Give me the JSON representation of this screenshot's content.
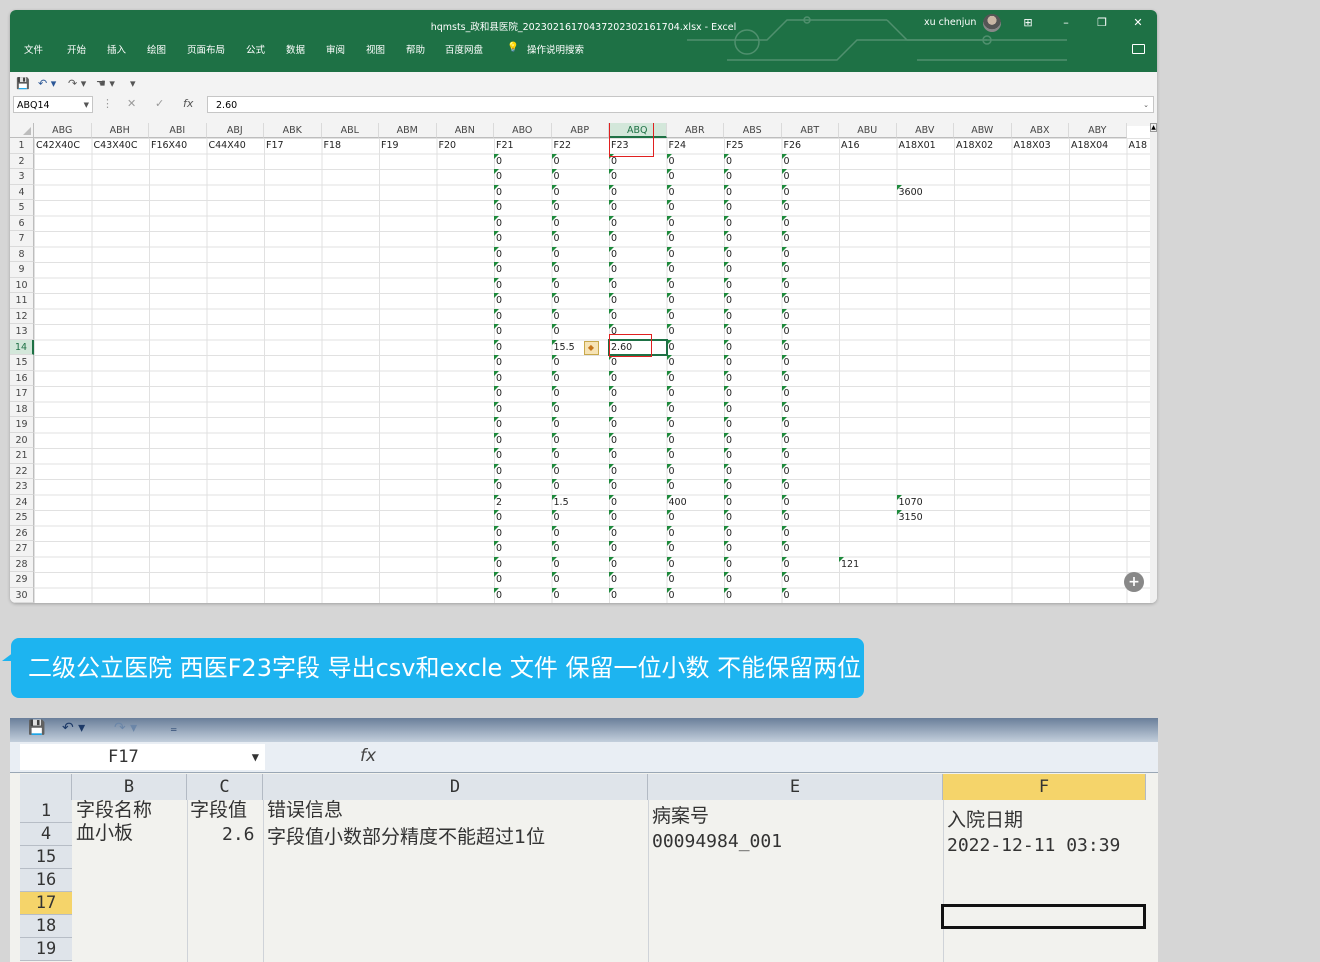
{
  "excel": {
    "title": "hqmsts_政和县医院_20230216170437202302161704.xlsx  -  Excel",
    "user": "xu chenjun",
    "menu": [
      "文件",
      "开始",
      "插入",
      "绘图",
      "页面布局",
      "公式",
      "数据",
      "审阅",
      "视图",
      "帮助",
      "百度网盘",
      "操作说明搜索"
    ],
    "namebox": "ABQ14",
    "formula": "2.60",
    "columns": [
      "ABG",
      "ABH",
      "ABI",
      "ABJ",
      "ABK",
      "ABL",
      "ABM",
      "ABN",
      "ABO",
      "ABP",
      "ABQ",
      "ABR",
      "ABS",
      "ABT",
      "ABU",
      "ABV",
      "ABW",
      "ABX",
      "ABY"
    ],
    "selected_column": "ABQ",
    "header_row": [
      "C42X40C",
      "C43X40C",
      "F16X40",
      "C44X40",
      "F17",
      "F18",
      "F19",
      "F20",
      "F21",
      "F22",
      "F23",
      "F24",
      "F25",
      "F26",
      "A16",
      "A18X01",
      "A18X02",
      "A18X03",
      "A18X04",
      "A18"
    ],
    "rows": [
      "1",
      "2",
      "3",
      "4",
      "5",
      "6",
      "7",
      "8",
      "9",
      "10",
      "11",
      "12",
      "13",
      "14",
      "15",
      "16",
      "17",
      "18",
      "19",
      "20",
      "21",
      "22",
      "23",
      "24",
      "25",
      "26",
      "27",
      "28",
      "29",
      "30"
    ],
    "selected_row": "14",
    "zero_value": "0",
    "special_values": {
      "r4_ABV": "3600",
      "r14_ABP": "15.5",
      "r14_ABQ": "2.60",
      "r24_ABO": "2",
      "r24_ABP": "1.5",
      "r24_ABR": "400",
      "r24_ABV": "1070",
      "r25_ABV": "3150",
      "r28_ABU": "121"
    }
  },
  "message": "二级公立医院 西医F23字段 导出csv和excle 文件 保留一位小数 不能保留两位",
  "photo": {
    "namebox": "F17",
    "fx": "fx",
    "columns": [
      "B",
      "C",
      "D",
      "E",
      "F"
    ],
    "rows": [
      "1",
      "4",
      "15",
      "16",
      "17",
      "18",
      "19"
    ],
    "selected_row": "17",
    "row1": {
      "B": "字段名称",
      "C": "字段值",
      "D": "错误信息",
      "E": "病案号",
      "F": "入院日期"
    },
    "row4": {
      "B": "血小板",
      "C": "2.6",
      "D": "字段值小数部分精度不能超过1位",
      "E": "00094984_001",
      "F": "2022-12-11 03:39"
    }
  }
}
